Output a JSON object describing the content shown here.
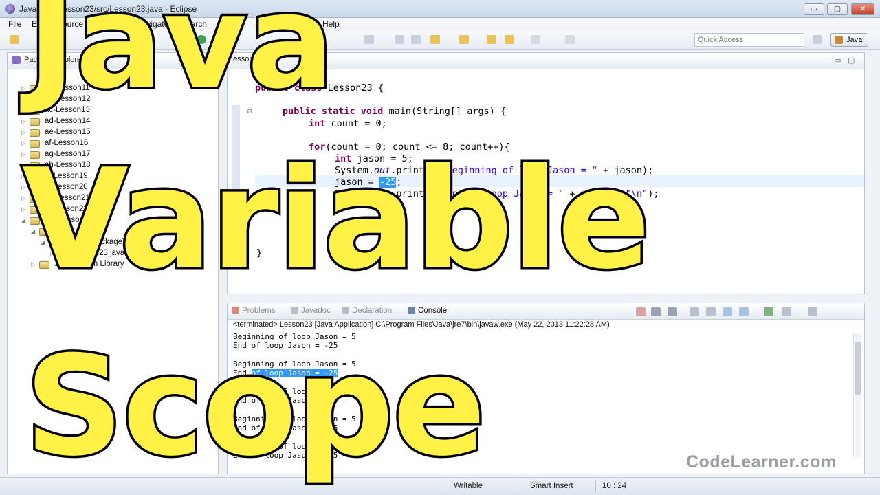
{
  "window": {
    "title": "Java - am-Lesson23/src/Lesson23.java - Eclipse",
    "minimize_label": "▭",
    "maximize_label": "▢",
    "close_label": "✕"
  },
  "menu": {
    "items": [
      "File",
      "Edit",
      "Source",
      "Refactor",
      "Navigate",
      "Search",
      "Project",
      "Run",
      "Window",
      "Help"
    ]
  },
  "toolbar": {
    "quick_access_placeholder": "Quick Access",
    "perspective_label": "Java"
  },
  "package_explorer": {
    "tab_label": "Package Explorer",
    "items": [
      {
        "label": "aa-Lesson11"
      },
      {
        "label": "ab-Lesson12"
      },
      {
        "label": "ac-Lesson13"
      },
      {
        "label": "ad-Lesson14"
      },
      {
        "label": "ae-Lesson15"
      },
      {
        "label": "af-Lesson16"
      },
      {
        "label": "ag-Lesson17"
      },
      {
        "label": "ah-Lesson18"
      },
      {
        "label": "ai-Lesson19"
      },
      {
        "label": "aj-Lesson20"
      },
      {
        "label": "ak-Lesson21"
      },
      {
        "label": "al-Lesson22"
      },
      {
        "label": "am-Lesson23"
      },
      {
        "label": "src"
      },
      {
        "label": "(default package)"
      },
      {
        "label": "Lesson23.java"
      },
      {
        "label": "JRE System Library"
      }
    ]
  },
  "editor": {
    "tab_label": "Lesson23.java",
    "lines": {
      "class_decl_kw": "public class ",
      "class_decl_rest": "Lesson23 {",
      "main_kw": "public static void ",
      "main_rest": "main(String[] args) {",
      "count_kw": "int ",
      "count_rest": "count = 0;",
      "for_kw": "for",
      "for_rest": "(count = 0; count <= 8; count++){",
      "jason_kw": "int ",
      "jason_rest": "jason = 5;",
      "println1_a": "System.",
      "println1_out": "out",
      "println1_b": ".println(",
      "println1_str": "\"Beginning of loop Jason = \"",
      "println1_c": " + jason);",
      "assign_a": "jason = ",
      "assign_sel": "-25",
      "assign_b": ";",
      "println2_a": "System.",
      "println2_out": "out",
      "println2_b": ".println(",
      "println2_str1": "\"End of loop Jason = \"",
      "println2_c": " + jason + ",
      "println2_str2": "\"\\n\"",
      "println2_d": ");",
      "close_for": "}",
      "close_class": "}"
    }
  },
  "console": {
    "tabs": [
      "Problems",
      "Javadoc",
      "Declaration",
      "Console"
    ],
    "status": "<terminated> Lesson23 [Java Application] C:\\Program Files\\Java\\jre7\\bin\\javaw.exe (May 22, 2013 11:22:28 AM)",
    "lines": [
      {
        "text": "Beginning of loop Jason = 5"
      },
      {
        "text": "End of loop Jason = -25"
      },
      {
        "text": ""
      },
      {
        "text": "Beginning of loop Jason = 5"
      },
      {
        "text": "End ",
        "selected": "of loop Jason = -25"
      },
      {
        "text": ""
      },
      {
        "text": "Beginning of loop Jason = 5"
      },
      {
        "text": "End of loop Jason = -25"
      },
      {
        "text": ""
      },
      {
        "text": "Beginning of loop Jason = 5"
      },
      {
        "text": "End of loop Jason = -25"
      },
      {
        "text": ""
      },
      {
        "text": "Beginning of loop Jason = 5"
      },
      {
        "text": "End of loop Jason = -25"
      }
    ]
  },
  "statusbar": {
    "writable": "Writable",
    "insert_mode": "Smart Insert",
    "position": "10 : 24"
  },
  "overlay": {
    "line1": "Java",
    "line2": "Variable",
    "line3": "Scope"
  },
  "watermark": "CodeLearner.com",
  "colors": {
    "overlay_fill": "#fff146",
    "overlay_stroke": "#000000",
    "keyword": "#7f0055",
    "string": "#2a00ff",
    "selection": "#3399ff"
  }
}
